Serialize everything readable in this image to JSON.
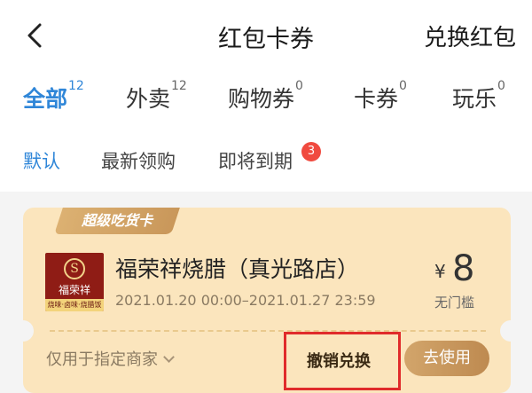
{
  "header": {
    "back_icon": "chevron-left-icon",
    "title": "红包卡券",
    "right_action": "兑换红包"
  },
  "tabs": [
    {
      "label": "全部",
      "count": "12",
      "active": true
    },
    {
      "label": "外卖",
      "count": "12",
      "active": false
    },
    {
      "label": "购物券",
      "count": "0",
      "active": false
    },
    {
      "label": "卡券",
      "count": "0",
      "active": false
    },
    {
      "label": "玩乐",
      "count": "0",
      "active": false
    }
  ],
  "subtabs": [
    {
      "label": "默认",
      "active": true
    },
    {
      "label": "最新领购",
      "active": false
    },
    {
      "label": "即将到期",
      "active": false,
      "badge": "3"
    }
  ],
  "coupon": {
    "card_type": "超级吃货卡",
    "logo": {
      "icon": "store-logo-icon",
      "mark": "S",
      "name": "福荣祥",
      "tagline": "烧味·卤味·烧腊饭"
    },
    "shop_name": "福荣祥烧腊（真光路店）",
    "validity": "2021.01.20 00:00–2021.01.27 23:59",
    "currency": "¥",
    "amount": "8",
    "threshold": "无门槛",
    "usage_scope": "仅用于指定商家",
    "revoke_label": "撤销兑换",
    "use_label": "去使用"
  },
  "colors": {
    "accent": "#2f86d8",
    "card_bg": "#fbe5bd",
    "button_gold": "#c9975a",
    "badge_red": "#f04a3f",
    "highlight_red": "#e02b2b"
  }
}
